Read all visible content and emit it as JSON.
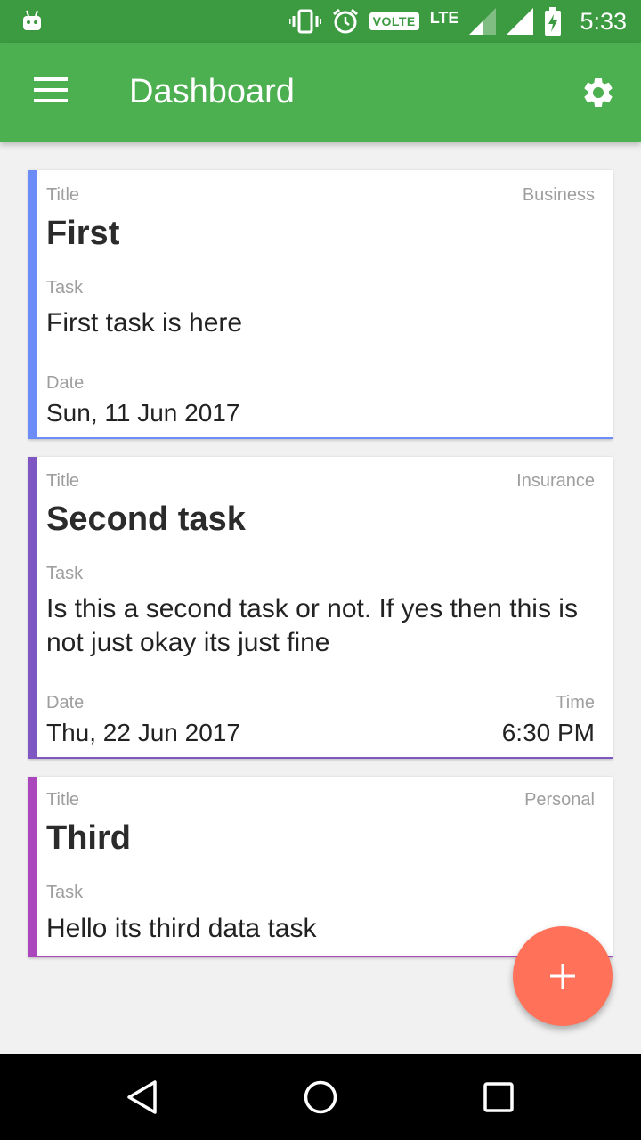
{
  "status_bar": {
    "volte": "VOLTE",
    "lte": "LTE",
    "time": "5:33"
  },
  "app_bar": {
    "title": "Dashboard",
    "menu_icon": "hamburger-menu-icon",
    "settings_icon": "gear-icon"
  },
  "colors": {
    "status_bar": "#3c9a40",
    "app_bar": "#4caf50",
    "fab": "#ff7259",
    "card1_accent": "#6c8cf8",
    "card2_accent": "#7e57c2",
    "card3_accent": "#ab47bc"
  },
  "cards": [
    {
      "title_label": "Title",
      "category": "Business",
      "title": "First",
      "task_label": "Task",
      "task": "First task is here",
      "date_label": "Date",
      "date": "Sun, 11 Jun 2017"
    },
    {
      "title_label": "Title",
      "category": "Insurance",
      "title": "Second task",
      "task_label": "Task",
      "task": "Is this a second task or not. If yes then this is not just okay its just fine",
      "date_label": "Date",
      "date": "Thu, 22 Jun 2017",
      "time_label": "Time",
      "time": "6:30 PM"
    },
    {
      "title_label": "Title",
      "category": "Personal",
      "title": "Third",
      "task_label": "Task",
      "task": "Hello its third data task"
    }
  ],
  "fab": {
    "icon": "plus-icon"
  },
  "nav_bar": {
    "back_icon": "back-triangle-icon",
    "home_icon": "home-circle-icon",
    "recents_icon": "recents-square-icon"
  }
}
